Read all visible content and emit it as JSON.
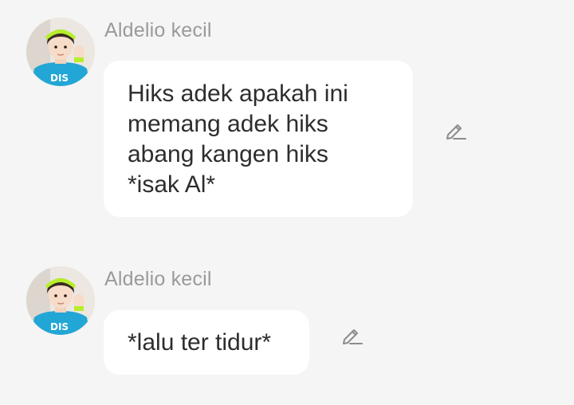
{
  "messages": [
    {
      "sender": "Aldelio kecil",
      "lines": [
        "Hiks adek apakah ini",
        "memang adek hiks",
        "abang kangen hiks",
        "*isak Al*"
      ],
      "edit_icon": "pencil-icon"
    },
    {
      "sender": "Aldelio kecil",
      "lines": [
        "*lalu ter tidur*"
      ],
      "edit_icon": "pencil-icon"
    }
  ],
  "colors": {
    "background": "#f5f5f5",
    "bubble": "#ffffff",
    "sender_text": "#9a9a9a",
    "message_text": "#2d2d2d",
    "icon": "#8c8c8c"
  }
}
